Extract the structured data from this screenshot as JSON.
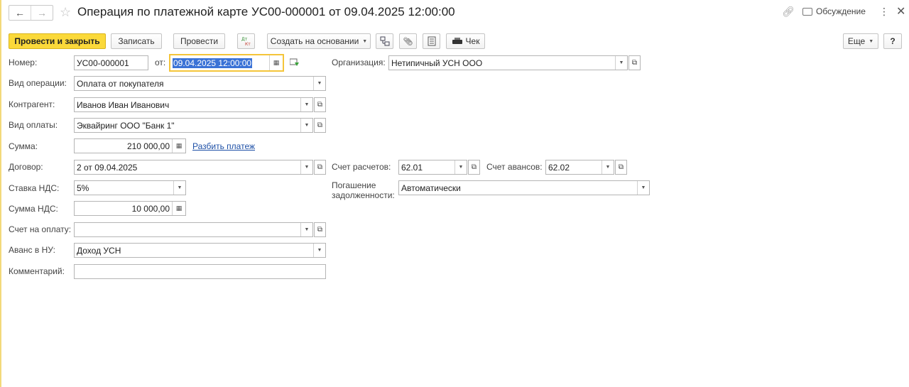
{
  "window": {
    "title": "Операция по платежной карте УС00-000001 от 09.04.2025 12:00:00",
    "discussion_label": "Обсуждение"
  },
  "toolbar": {
    "post_close_label": "Провести и закрыть",
    "save_label": "Записать",
    "post_label": "Провести",
    "dtkt_label": "Дт Кт",
    "create_based_label": "Создать на основании",
    "check_label": "Чек",
    "more_label": "Еще",
    "help_label": "?"
  },
  "form": {
    "number_label": "Номер:",
    "number_value": "УС00-000001",
    "date_label": "от:",
    "date_value": "09.04.2025 12:00:00",
    "org_label": "Организация:",
    "org_value": "Нетипичный УСН ООО",
    "op_type_label": "Вид операции:",
    "op_type_value": "Оплата от покупателя",
    "counterparty_label": "Контрагент:",
    "counterparty_value": "Иванов Иван Иванович",
    "payment_type_label": "Вид оплаты:",
    "payment_type_value": "Эквайринг ООО \"Банк 1\"",
    "sum_label": "Сумма:",
    "sum_value": "210 000,00",
    "split_link": "Разбить платеж",
    "contract_label": "Договор:",
    "contract_value": "2 от 09.04.2025",
    "settlement_account_label": "Счет расчетов:",
    "settlement_account_value": "62.01",
    "advance_account_label": "Счет авансов:",
    "advance_account_value": "62.02",
    "vat_rate_label": "Ставка НДС:",
    "vat_rate_value": "5%",
    "debt_repay_label_1": "Погашение",
    "debt_repay_label_2": "задолженности:",
    "debt_repay_value": "Автоматически",
    "vat_sum_label": "Сумма НДС:",
    "vat_sum_value": "10 000,00",
    "invoice_label": "Счет на оплату:",
    "invoice_value": "",
    "advance_nu_label": "Аванс в НУ:",
    "advance_nu_value": "Доход УСН",
    "comment_label": "Комментарий:",
    "comment_value": ""
  },
  "icons": [
    "back-arrow-icon",
    "forward-arrow-icon",
    "star-icon",
    "link-icon",
    "discussion-icon",
    "more-icon",
    "close-icon",
    "structure-icon",
    "paperclip-icon",
    "document-icon",
    "printer-icon",
    "calendar-icon",
    "calculator-icon",
    "open-icon"
  ],
  "colors": {
    "primary_button": "#fbd93a",
    "selection": "#3a72d6",
    "focus_border": "#f4c53a",
    "link": "#1d4fa6"
  }
}
